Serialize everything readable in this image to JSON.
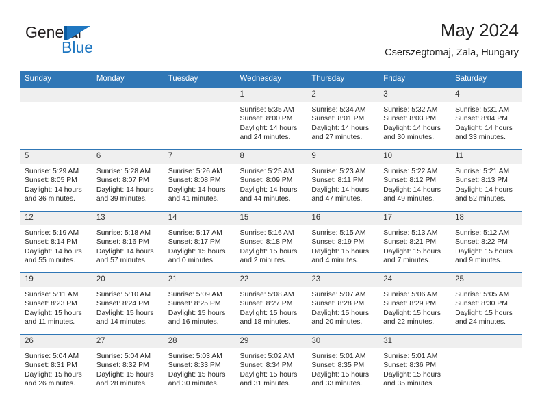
{
  "brand": {
    "word_top": "General",
    "word_bottom": "Blue",
    "mark": "triangle-logo",
    "color_dark": "#231f20",
    "color_blue": "#1f77c1"
  },
  "header": {
    "title": "May 2024",
    "subtitle": "Cserszegtomaj, Zala, Hungary"
  },
  "theme": {
    "header_blue": "#3077b6",
    "daynum_gray": "#efefef"
  },
  "weekday_headers": [
    "Sunday",
    "Monday",
    "Tuesday",
    "Wednesday",
    "Thursday",
    "Friday",
    "Saturday"
  ],
  "labels": {
    "sunrise": "Sunrise:",
    "sunset": "Sunset:",
    "daylight": "Daylight:"
  },
  "weeks": [
    [
      {
        "day": "",
        "empty": true
      },
      {
        "day": "",
        "empty": true
      },
      {
        "day": "",
        "empty": true
      },
      {
        "day": "1",
        "sunrise": "Sunrise: 5:35 AM",
        "sunset": "Sunset: 8:00 PM",
        "daylight1": "Daylight: 14 hours",
        "daylight2": "and 24 minutes."
      },
      {
        "day": "2",
        "sunrise": "Sunrise: 5:34 AM",
        "sunset": "Sunset: 8:01 PM",
        "daylight1": "Daylight: 14 hours",
        "daylight2": "and 27 minutes."
      },
      {
        "day": "3",
        "sunrise": "Sunrise: 5:32 AM",
        "sunset": "Sunset: 8:03 PM",
        "daylight1": "Daylight: 14 hours",
        "daylight2": "and 30 minutes."
      },
      {
        "day": "4",
        "sunrise": "Sunrise: 5:31 AM",
        "sunset": "Sunset: 8:04 PM",
        "daylight1": "Daylight: 14 hours",
        "daylight2": "and 33 minutes."
      }
    ],
    [
      {
        "day": "5",
        "sunrise": "Sunrise: 5:29 AM",
        "sunset": "Sunset: 8:05 PM",
        "daylight1": "Daylight: 14 hours",
        "daylight2": "and 36 minutes."
      },
      {
        "day": "6",
        "sunrise": "Sunrise: 5:28 AM",
        "sunset": "Sunset: 8:07 PM",
        "daylight1": "Daylight: 14 hours",
        "daylight2": "and 39 minutes."
      },
      {
        "day": "7",
        "sunrise": "Sunrise: 5:26 AM",
        "sunset": "Sunset: 8:08 PM",
        "daylight1": "Daylight: 14 hours",
        "daylight2": "and 41 minutes."
      },
      {
        "day": "8",
        "sunrise": "Sunrise: 5:25 AM",
        "sunset": "Sunset: 8:09 PM",
        "daylight1": "Daylight: 14 hours",
        "daylight2": "and 44 minutes."
      },
      {
        "day": "9",
        "sunrise": "Sunrise: 5:23 AM",
        "sunset": "Sunset: 8:11 PM",
        "daylight1": "Daylight: 14 hours",
        "daylight2": "and 47 minutes."
      },
      {
        "day": "10",
        "sunrise": "Sunrise: 5:22 AM",
        "sunset": "Sunset: 8:12 PM",
        "daylight1": "Daylight: 14 hours",
        "daylight2": "and 49 minutes."
      },
      {
        "day": "11",
        "sunrise": "Sunrise: 5:21 AM",
        "sunset": "Sunset: 8:13 PM",
        "daylight1": "Daylight: 14 hours",
        "daylight2": "and 52 minutes."
      }
    ],
    [
      {
        "day": "12",
        "sunrise": "Sunrise: 5:19 AM",
        "sunset": "Sunset: 8:14 PM",
        "daylight1": "Daylight: 14 hours",
        "daylight2": "and 55 minutes."
      },
      {
        "day": "13",
        "sunrise": "Sunrise: 5:18 AM",
        "sunset": "Sunset: 8:16 PM",
        "daylight1": "Daylight: 14 hours",
        "daylight2": "and 57 minutes."
      },
      {
        "day": "14",
        "sunrise": "Sunrise: 5:17 AM",
        "sunset": "Sunset: 8:17 PM",
        "daylight1": "Daylight: 15 hours",
        "daylight2": "and 0 minutes."
      },
      {
        "day": "15",
        "sunrise": "Sunrise: 5:16 AM",
        "sunset": "Sunset: 8:18 PM",
        "daylight1": "Daylight: 15 hours",
        "daylight2": "and 2 minutes."
      },
      {
        "day": "16",
        "sunrise": "Sunrise: 5:15 AM",
        "sunset": "Sunset: 8:19 PM",
        "daylight1": "Daylight: 15 hours",
        "daylight2": "and 4 minutes."
      },
      {
        "day": "17",
        "sunrise": "Sunrise: 5:13 AM",
        "sunset": "Sunset: 8:21 PM",
        "daylight1": "Daylight: 15 hours",
        "daylight2": "and 7 minutes."
      },
      {
        "day": "18",
        "sunrise": "Sunrise: 5:12 AM",
        "sunset": "Sunset: 8:22 PM",
        "daylight1": "Daylight: 15 hours",
        "daylight2": "and 9 minutes."
      }
    ],
    [
      {
        "day": "19",
        "sunrise": "Sunrise: 5:11 AM",
        "sunset": "Sunset: 8:23 PM",
        "daylight1": "Daylight: 15 hours",
        "daylight2": "and 11 minutes."
      },
      {
        "day": "20",
        "sunrise": "Sunrise: 5:10 AM",
        "sunset": "Sunset: 8:24 PM",
        "daylight1": "Daylight: 15 hours",
        "daylight2": "and 14 minutes."
      },
      {
        "day": "21",
        "sunrise": "Sunrise: 5:09 AM",
        "sunset": "Sunset: 8:25 PM",
        "daylight1": "Daylight: 15 hours",
        "daylight2": "and 16 minutes."
      },
      {
        "day": "22",
        "sunrise": "Sunrise: 5:08 AM",
        "sunset": "Sunset: 8:27 PM",
        "daylight1": "Daylight: 15 hours",
        "daylight2": "and 18 minutes."
      },
      {
        "day": "23",
        "sunrise": "Sunrise: 5:07 AM",
        "sunset": "Sunset: 8:28 PM",
        "daylight1": "Daylight: 15 hours",
        "daylight2": "and 20 minutes."
      },
      {
        "day": "24",
        "sunrise": "Sunrise: 5:06 AM",
        "sunset": "Sunset: 8:29 PM",
        "daylight1": "Daylight: 15 hours",
        "daylight2": "and 22 minutes."
      },
      {
        "day": "25",
        "sunrise": "Sunrise: 5:05 AM",
        "sunset": "Sunset: 8:30 PM",
        "daylight1": "Daylight: 15 hours",
        "daylight2": "and 24 minutes."
      }
    ],
    [
      {
        "day": "26",
        "sunrise": "Sunrise: 5:04 AM",
        "sunset": "Sunset: 8:31 PM",
        "daylight1": "Daylight: 15 hours",
        "daylight2": "and 26 minutes."
      },
      {
        "day": "27",
        "sunrise": "Sunrise: 5:04 AM",
        "sunset": "Sunset: 8:32 PM",
        "daylight1": "Daylight: 15 hours",
        "daylight2": "and 28 minutes."
      },
      {
        "day": "28",
        "sunrise": "Sunrise: 5:03 AM",
        "sunset": "Sunset: 8:33 PM",
        "daylight1": "Daylight: 15 hours",
        "daylight2": "and 30 minutes."
      },
      {
        "day": "29",
        "sunrise": "Sunrise: 5:02 AM",
        "sunset": "Sunset: 8:34 PM",
        "daylight1": "Daylight: 15 hours",
        "daylight2": "and 31 minutes."
      },
      {
        "day": "30",
        "sunrise": "Sunrise: 5:01 AM",
        "sunset": "Sunset: 8:35 PM",
        "daylight1": "Daylight: 15 hours",
        "daylight2": "and 33 minutes."
      },
      {
        "day": "31",
        "sunrise": "Sunrise: 5:01 AM",
        "sunset": "Sunset: 8:36 PM",
        "daylight1": "Daylight: 15 hours",
        "daylight2": "and 35 minutes."
      },
      {
        "day": "",
        "empty": true
      }
    ]
  ]
}
